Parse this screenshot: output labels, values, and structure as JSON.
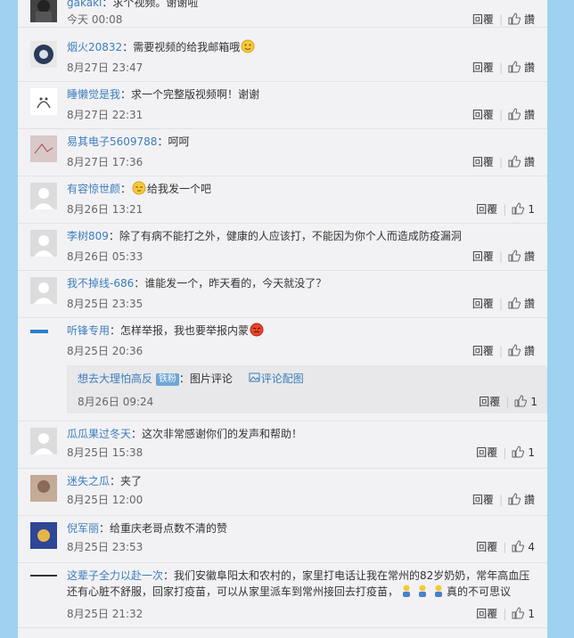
{
  "comments": [
    {
      "user": "gakaki",
      "text": "：求个视频。谢谢啦",
      "date": "今天 00:08",
      "reply": "回覆",
      "like": "讚"
    },
    {
      "user": "烟火20832",
      "text": "：需要视频的给我邮箱哦",
      "date": "8月27日 23:47",
      "reply": "回覆",
      "like": "讚"
    },
    {
      "user": "睡懒觉是我",
      "text": "：求一个完整版视频啊！谢谢",
      "date": "8月27日 22:31",
      "reply": "回覆",
      "like": "讚"
    },
    {
      "user": "易其电子5609788",
      "text": "：呵呵",
      "date": "8月27日 17:36",
      "reply": "回覆",
      "like": "讚"
    },
    {
      "user": "有容惊世颜",
      "text": "：",
      "text2": "给我发一个吧",
      "date": "8月26日 13:21",
      "reply": "回覆",
      "like": "1"
    },
    {
      "user": "李树809",
      "text": "：除了有病不能打之外，健康的人应该打，不能因为你个人而造成防疫漏洞",
      "date": "8月26日 05:33",
      "reply": "回覆",
      "like": "讚"
    },
    {
      "user": "我不掉线-686",
      "text": "：谁能发一个，昨天看的，今天就没了？",
      "date": "8月25日 23:35",
      "reply": "回覆",
      "like": "讚"
    },
    {
      "user": "听锋专用",
      "text": "：怎样举报，我也要举报内蒙",
      "date": "8月25日 20:36",
      "reply": "回覆",
      "like": "讚"
    },
    {
      "user": "瓜瓜果过冬天",
      "text": "：这次非常感谢你们的发声和帮助！",
      "date": "8月25日 15:38",
      "reply": "回覆",
      "like": "1"
    },
    {
      "user": "迷失之瓜",
      "text": "：夹了",
      "date": "8月25日 12:00",
      "reply": "回覆",
      "like": "讚"
    },
    {
      "user": "倪军丽",
      "text": "：给重庆老哥点数不清的赞",
      "date": "8月25日 23:53",
      "reply": "回覆",
      "like": "4"
    },
    {
      "user": "这辈子全力以赴一次",
      "text": "：我们安徽阜阳太和农村的，家里打电话让我在常州的82岁奶奶，常年高血压还有心脏不舒服，回家打疫苗，可以从家里派车到常州接回去打疫苗，",
      "text2": "真的不可思议",
      "date": "8月25日 21:32",
      "reply": "回覆",
      "like": "1"
    }
  ],
  "subreply": {
    "user": "想去大理怕高反",
    "badge": "铁粉",
    "text": "：图片评论",
    "link": "评论配图",
    "date": "8月26日 09:24",
    "reply": "回覆",
    "like": "1"
  }
}
